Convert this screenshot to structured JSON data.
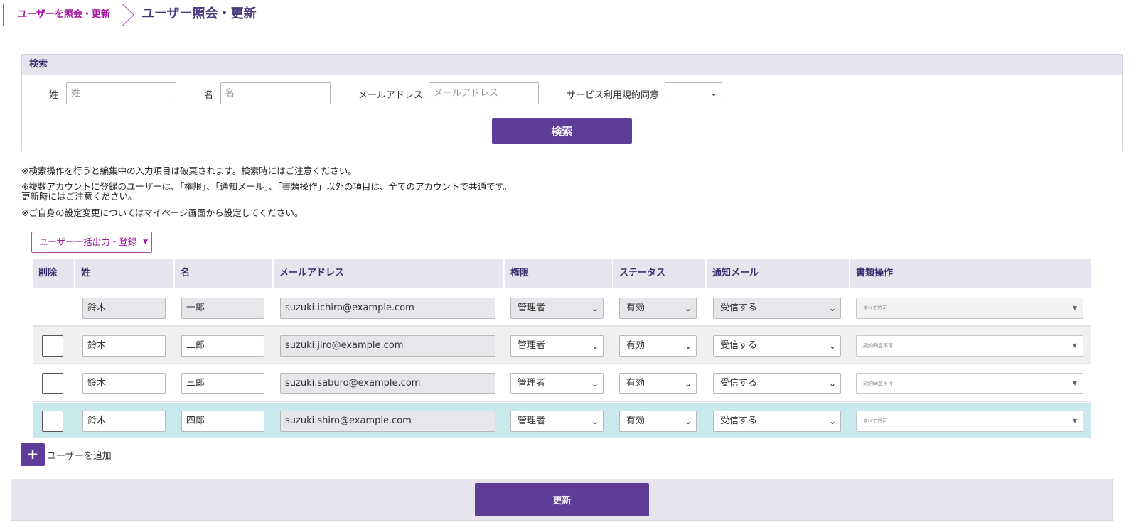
{
  "breadcrumb": {
    "label": "ユーザーを照会・更新"
  },
  "page_title": "ユーザー照会・更新",
  "search": {
    "heading": "検索",
    "last_name_label": "姓",
    "last_name_placeholder": "姓",
    "first_name_label": "名",
    "first_name_placeholder": "名",
    "email_label": "メールアドレス",
    "email_placeholder": "メールアドレス",
    "tos_label": "サービス利用規約同意",
    "tos_value": "",
    "button": "検索"
  },
  "notes": {
    "line1": "※検索操作を行うと編集中の入力項目は破棄されます。検索時にはご注意ください。",
    "line2": "※複数アカウントに登録のユーザーは、「権限」、「通知メール」、「書類操作」以外の項目は、全てのアカウントで共通です。",
    "line3": "更新時にはご注意ください。",
    "line4": "※ご自身の設定変更についてはマイページ画面から設定してください。"
  },
  "bulk_button": {
    "label": "ユーザー一括出力・登録"
  },
  "table": {
    "headers": {
      "delete": "削除",
      "last_name": "姓",
      "first_name": "名",
      "email": "メールアドレス",
      "role": "権限",
      "status": "ステータス",
      "notify": "通知メール",
      "doc_ops": "書類操作"
    },
    "rows": [
      {
        "last_name": "鈴木",
        "first_name": "一郎",
        "email": "suzuki.ichiro@example.com",
        "role": "管理者",
        "status": "有効",
        "notify": "受信する",
        "doc_ops": "すべて許可"
      },
      {
        "last_name": "鈴木",
        "first_name": "二郎",
        "email": "suzuki.jiro@example.com",
        "role": "管理者",
        "status": "有効",
        "notify": "受信する",
        "doc_ops": "契約同意不可"
      },
      {
        "last_name": "鈴木",
        "first_name": "三郎",
        "email": "suzuki.saburo@example.com",
        "role": "管理者",
        "status": "有効",
        "notify": "受信する",
        "doc_ops": "契約同意不可"
      },
      {
        "last_name": "鈴木",
        "first_name": "四郎",
        "email": "suzuki.shiro@example.com",
        "role": "管理者",
        "status": "有効",
        "notify": "受信する",
        "doc_ops": "すべて許可"
      }
    ]
  },
  "add_user": {
    "icon": "+",
    "label": "ユーザーを追加"
  },
  "update_button": {
    "label": "更新"
  },
  "colors": {
    "brand": "#5e3d99",
    "breadcrumb_accent": "#a3139e",
    "highlight_row": "#c9e9ec",
    "header_bg": "#e6e4ed"
  }
}
